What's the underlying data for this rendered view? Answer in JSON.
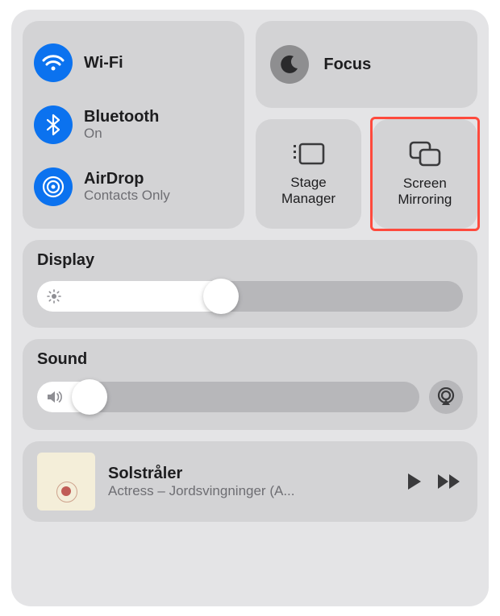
{
  "connectivity": {
    "wifi": {
      "label": "Wi-Fi",
      "status": ""
    },
    "bluetooth": {
      "label": "Bluetooth",
      "status": "On"
    },
    "airdrop": {
      "label": "AirDrop",
      "status": "Contacts Only"
    }
  },
  "focus": {
    "label": "Focus"
  },
  "tiles": {
    "stage_manager": {
      "label": "Stage\nManager"
    },
    "screen_mirroring": {
      "label": "Screen\nMirroring"
    }
  },
  "sliders": {
    "display": {
      "title": "Display",
      "percent": 47
    },
    "sound": {
      "title": "Sound",
      "percent": 18
    }
  },
  "media": {
    "title": "Solstråler",
    "artist": "Actress – Jordsvingninger (A..."
  }
}
